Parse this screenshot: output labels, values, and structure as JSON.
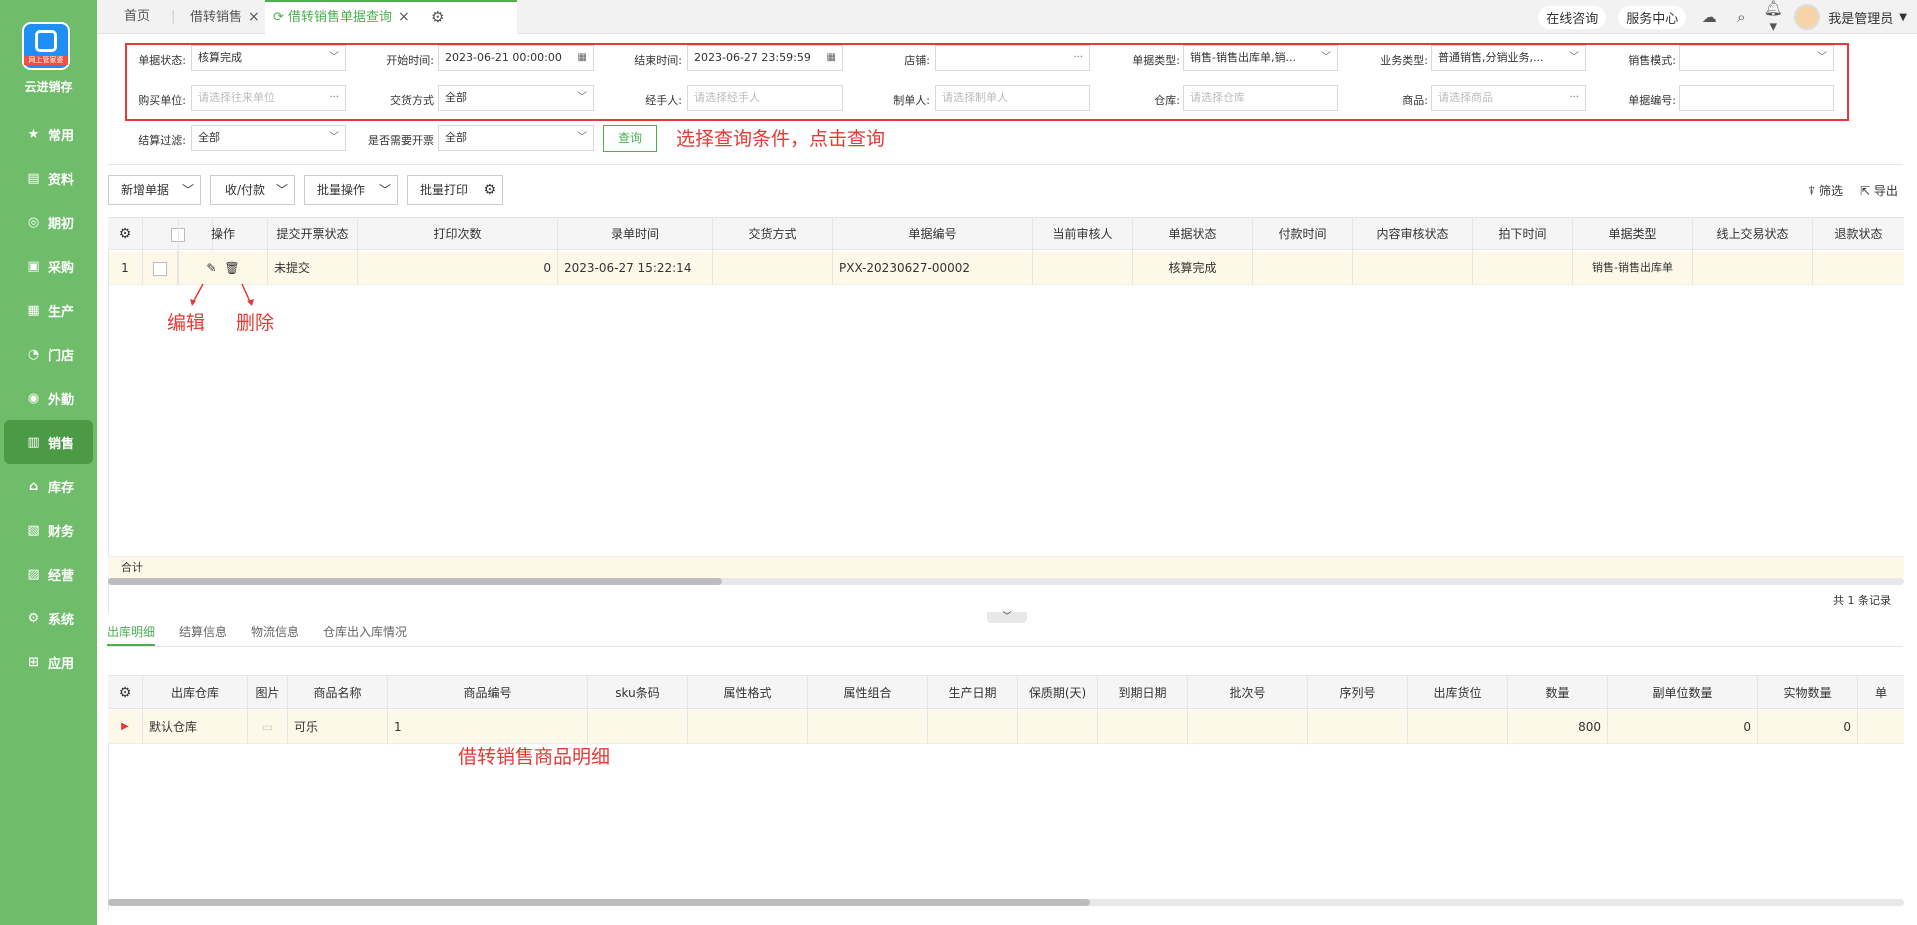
{
  "sidebar": {
    "brand": "云进销存",
    "logo_badge": "网上管家婆",
    "items": [
      {
        "label": "常用",
        "icon": "star-icon"
      },
      {
        "label": "资料",
        "icon": "document-icon"
      },
      {
        "label": "期初",
        "icon": "target-icon"
      },
      {
        "label": "采购",
        "icon": "purchase-icon"
      },
      {
        "label": "生产",
        "icon": "production-icon"
      },
      {
        "label": "门店",
        "icon": "pie-icon"
      },
      {
        "label": "外勤",
        "icon": "field-icon"
      },
      {
        "label": "销售",
        "icon": "bar-chart-icon",
        "active": true
      },
      {
        "label": "库存",
        "icon": "house-icon"
      },
      {
        "label": "财务",
        "icon": "finance-icon"
      },
      {
        "label": "经营",
        "icon": "trend-icon"
      },
      {
        "label": "系统",
        "icon": "gear-icon"
      },
      {
        "label": "应用",
        "icon": "plus-square-icon"
      }
    ]
  },
  "tabs": {
    "home": "首页",
    "tab1": "借转销售",
    "tab2": "借转销售单据查询"
  },
  "topbar": {
    "consult": "在线咨询",
    "service": "服务中心",
    "user": "我是管理员"
  },
  "filters": {
    "doc_status_label": "单据状态:",
    "doc_status": "核算完成",
    "start_label": "开始时间:",
    "start": "2023-06-21 00:00:00",
    "end_label": "结束时间:",
    "end": "2023-06-27 23:59:59",
    "shop_label": "店铺:",
    "doc_type_label": "单据类型:",
    "doc_type": "销售-销售出库单,销...",
    "biz_type_label": "业务类型:",
    "biz_type": "普通销售,分销业务,...",
    "sales_mode_label": "销售模式:",
    "buyer_label": "购买单位:",
    "buyer_ph": "请选择往来单位",
    "delivery_label": "交货方式",
    "delivery": "全部",
    "handler_label": "经手人:",
    "handler_ph": "请选择经手人",
    "maker_label": "制单人:",
    "maker_ph": "请选择制单人",
    "warehouse_label": "仓库:",
    "warehouse_ph": "请选择仓库",
    "product_label": "商品:",
    "product_ph": "请选择商品",
    "docno_label": "单据编号:",
    "settle_label": "结算过滤:",
    "settle": "全部",
    "invoice_label": "是否需要开票",
    "invoice": "全部",
    "query_btn": "查询"
  },
  "annotations": {
    "query_hint": "选择查询条件，点击查询",
    "edit": "编辑",
    "delete": "删除",
    "detail_hint": "借转销售商品明细"
  },
  "toolbar": {
    "new_doc": "新增单据",
    "receive_pay": "收/付款",
    "batch_op": "批量操作",
    "batch_print": "批量打印",
    "filter": "筛选",
    "export": "导出"
  },
  "grid": {
    "headers": [
      "操作",
      "提交开票状态",
      "打印次数",
      "录单时间",
      "交货方式",
      "单据编号",
      "当前审核人",
      "单据状态",
      "付款时间",
      "内容审核状态",
      "拍下时间",
      "单据类型",
      "线上交易状态",
      "退款状态"
    ],
    "row": {
      "index": "1",
      "invoice_status": "未提交",
      "print_count": "0",
      "time": "2023-06-27 15:22:14",
      "docno": "PXX-20230627-00002",
      "status": "核算完成",
      "type": "销售-销售出库单"
    },
    "sum_label": "合计",
    "record_count": "共 1 条记录"
  },
  "subtabs": [
    "出库明细",
    "结算信息",
    "物流信息",
    "仓库出入库情况"
  ],
  "detail": {
    "headers": [
      "出库仓库",
      "图片",
      "商品名称",
      "商品编号",
      "sku条码",
      "属性格式",
      "属性组合",
      "生产日期",
      "保质期(天)",
      "到期日期",
      "批次号",
      "序列号",
      "出库货位",
      "数量",
      "副单位数量",
      "实物数量",
      "单"
    ],
    "row": {
      "warehouse": "默认仓库",
      "name": "可乐",
      "code": "1",
      "qty": "800",
      "sub_qty": "0",
      "real_qty": "0"
    }
  },
  "colors": {
    "sidebar": "#6fbd6a",
    "accent": "#4caf50",
    "annotation": "#e53935"
  }
}
